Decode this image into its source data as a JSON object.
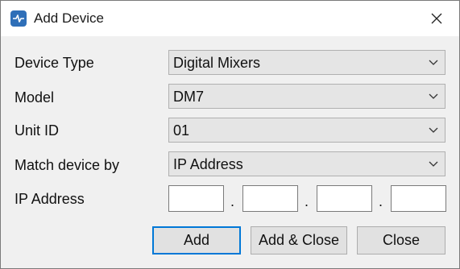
{
  "window": {
    "title": "Add Device",
    "app_icon": "app-logo-icon",
    "close_icon": "close-icon"
  },
  "form": {
    "device_type": {
      "label": "Device Type",
      "value": "Digital Mixers"
    },
    "model": {
      "label": "Model",
      "value": "DM7"
    },
    "unit_id": {
      "label": "Unit ID",
      "value": "01"
    },
    "match_by": {
      "label": "Match device by",
      "value": "IP Address"
    },
    "ip_address": {
      "label": "IP Address",
      "octets": [
        "",
        "",
        "",
        ""
      ],
      "separator": "."
    },
    "dropdown_icon": "chevron-down-icon"
  },
  "buttons": {
    "add": "Add",
    "add_close": "Add & Close",
    "close": "Close"
  },
  "colors": {
    "accent": "#0078d7",
    "icon_blue": "#2f6fb8"
  }
}
